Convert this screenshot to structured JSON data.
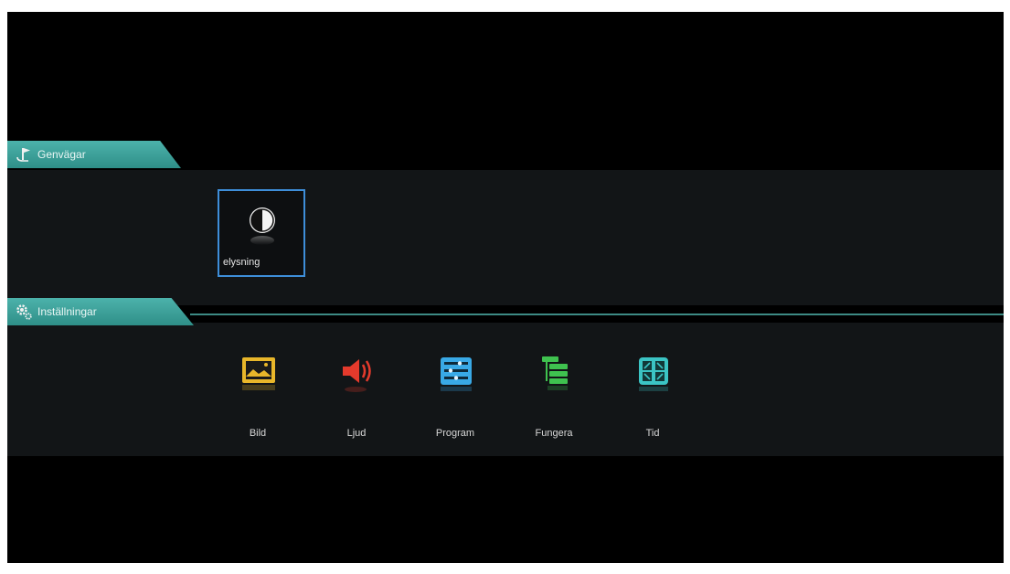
{
  "sections": {
    "shortcuts": {
      "label": "Genvägar",
      "icon": "flag-icon",
      "items": [
        {
          "label": "elysning",
          "icon": "contrast-icon",
          "selected": true
        }
      ]
    },
    "settings": {
      "label": "Inställningar",
      "icon": "gears-icon",
      "items": [
        {
          "label": "Bild",
          "icon": "picture-icon",
          "color": "#e8b62a"
        },
        {
          "label": "Ljud",
          "icon": "speaker-icon",
          "color": "#e43a2c"
        },
        {
          "label": "Program",
          "icon": "channel-list-icon",
          "color": "#39a9e6"
        },
        {
          "label": "Fungera",
          "icon": "function-list-icon",
          "color": "#3fc24f"
        },
        {
          "label": "Tid",
          "icon": "clock-tiles-icon",
          "color": "#3bc4c4"
        }
      ]
    }
  },
  "colors": {
    "accent": "#3c9f98",
    "selection_border": "#3e8ed9",
    "background": "#000000"
  }
}
